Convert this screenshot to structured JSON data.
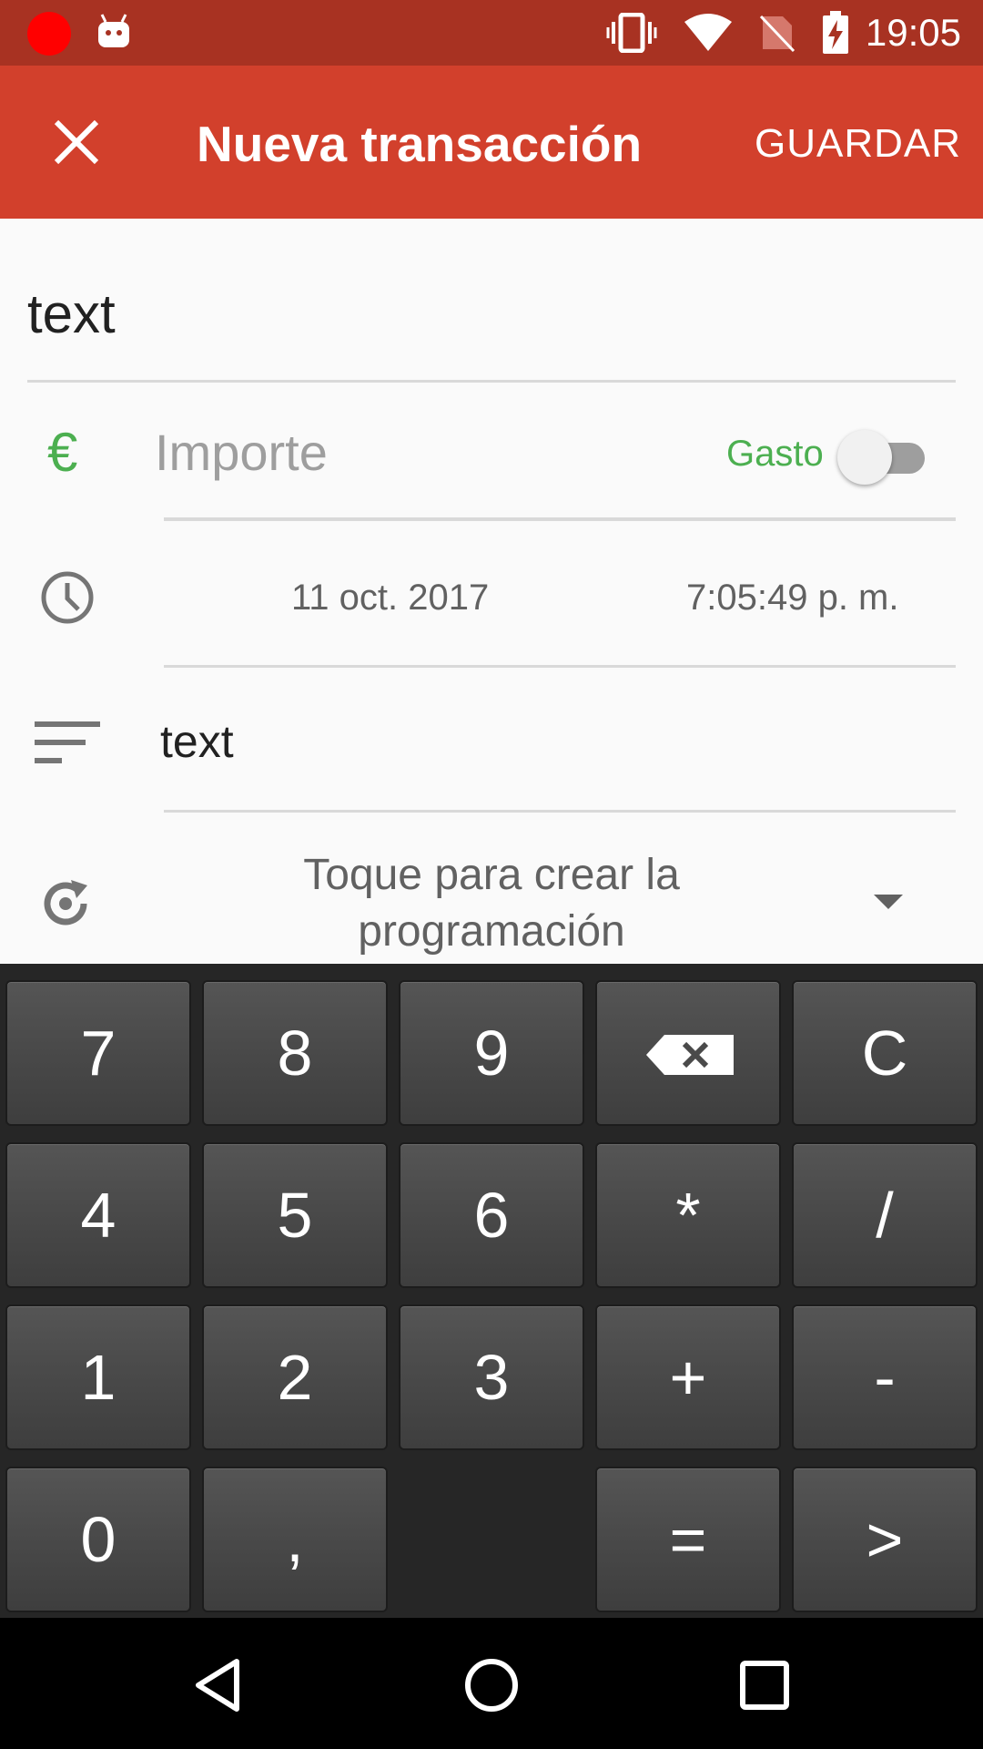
{
  "status_bar": {
    "time": "19:05",
    "icons": [
      "record-icon",
      "android-icon",
      "vibrate-icon",
      "wifi-icon",
      "no-sim-icon",
      "battery-charging-icon"
    ]
  },
  "app_bar": {
    "title": "Nueva transacción",
    "save_label": "GUARDAR",
    "close_icon": "close-icon",
    "color": "#d2402c"
  },
  "form": {
    "name_value": "text",
    "amount": {
      "currency_symbol": "€",
      "placeholder": "Importe",
      "type_label": "Gasto",
      "type_toggle_on": false
    },
    "date": "11 oct. 2017",
    "time": "7:05:49 p. m.",
    "notes_value": "text",
    "schedule_label": "Toque para crear la programación"
  },
  "keypad": {
    "keys": [
      {
        "id": "key-7",
        "label": "7"
      },
      {
        "id": "key-8",
        "label": "8"
      },
      {
        "id": "key-9",
        "label": "9"
      },
      {
        "id": "key-backspace",
        "label": "",
        "icon": "backspace-icon"
      },
      {
        "id": "key-clear",
        "label": "C"
      },
      {
        "id": "key-4",
        "label": "4"
      },
      {
        "id": "key-5",
        "label": "5"
      },
      {
        "id": "key-6",
        "label": "6"
      },
      {
        "id": "key-multiply",
        "label": "*"
      },
      {
        "id": "key-divide",
        "label": "/"
      },
      {
        "id": "key-1",
        "label": "1"
      },
      {
        "id": "key-2",
        "label": "2"
      },
      {
        "id": "key-3",
        "label": "3"
      },
      {
        "id": "key-plus",
        "label": "+"
      },
      {
        "id": "key-minus",
        "label": "-"
      },
      {
        "id": "key-0",
        "label": "0"
      },
      {
        "id": "key-comma",
        "label": ","
      },
      {
        "id": "key-equals",
        "label": "="
      },
      {
        "id": "key-next",
        "label": ">"
      }
    ]
  },
  "nav_bar": {
    "icons": [
      "back-icon",
      "home-icon",
      "recents-icon"
    ]
  },
  "colors": {
    "accent_green": "#4caf50",
    "status_bar": "#a83222"
  }
}
